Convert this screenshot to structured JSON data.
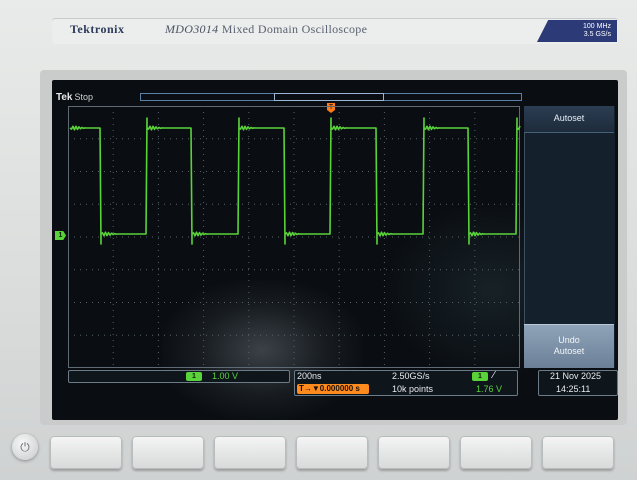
{
  "device": {
    "brand": "Tektronix",
    "model": "MDO3014",
    "model_desc": "Mixed Domain Oscilloscope",
    "bandwidth": "100 MHz",
    "sample_rate_spec": "3.5 GS/s"
  },
  "status": {
    "tek": "Tek",
    "acq_state": "Stop"
  },
  "side_menu": {
    "autoset_label": "Autoset",
    "undo_line1": "Undo",
    "undo_line2": "Autoset"
  },
  "channel1": {
    "number": "1",
    "scale": "1.00 V",
    "color": "#5ad33a"
  },
  "horizontal": {
    "time_per_div": "200ns",
    "trigger_delay": "T→▼0.000000 s",
    "sample_rate": "2.50GS/s",
    "record_length": "10k points"
  },
  "trigger": {
    "source": "1",
    "slope_icon": "rising-edge",
    "level": "1.76 V",
    "marker_color": "#ff7a1a"
  },
  "datetime": {
    "date": "21 Nov 2025",
    "time": "14:25:11"
  },
  "icons": {
    "power": "power-icon",
    "ch1_marker": "1",
    "trigger_marker": "T"
  }
}
